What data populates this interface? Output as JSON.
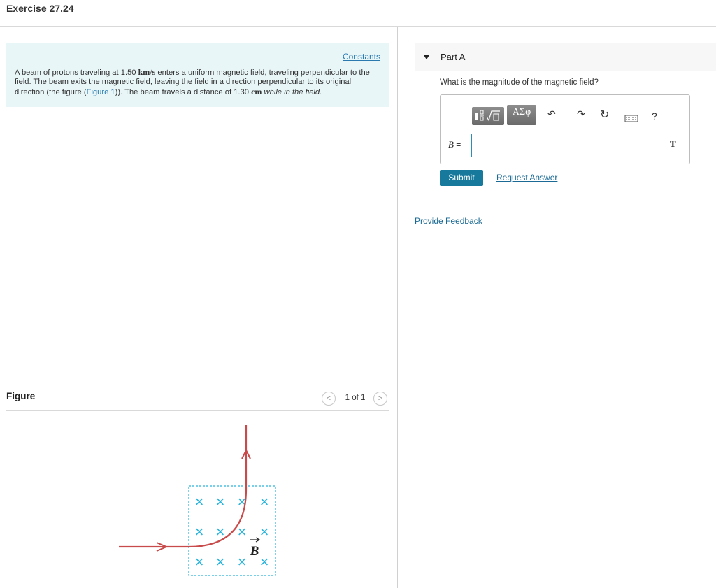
{
  "header": {
    "title": "Exercise 27.24"
  },
  "problem": {
    "constants_link": "Constants",
    "text_part1": "A beam of protons traveling at 1.50 ",
    "speed_unit": "km/s",
    "text_part2": " enters a uniform magnetic field, traveling perpendicular to the field. The beam exits the magnetic field, leaving the field in a direction perpendicular to its original direction (the figure (",
    "figure_link": "Figure 1",
    "text_part3": ")). The beam travels a distance of 1.30 ",
    "distance_unit": "cm",
    "text_part4": "while in the field."
  },
  "figure": {
    "label": "Figure",
    "pager_prev": "<",
    "pager_count": "1 of 1",
    "pager_next": ">",
    "field_label": "B",
    "field_symbol": "×",
    "colors": {
      "path": "#c94a4a",
      "field": "#2ab4dc"
    }
  },
  "part_a": {
    "label": "Part A",
    "question": "What is the magnitude of the magnetic field?",
    "toolbar": {
      "template_icon": "template-icon",
      "greek_label": "ΑΣφ",
      "undo_icon": "↶",
      "redo_icon": "↷",
      "reset_icon": "↻",
      "keyboard_icon": "keyboard-icon",
      "help_label": "?"
    },
    "variable_label": "B",
    "equals": " =",
    "input_value": "",
    "unit": "T",
    "submit_label": "Submit",
    "request_answer_label": "Request Answer"
  },
  "feedback_link": "Provide Feedback"
}
